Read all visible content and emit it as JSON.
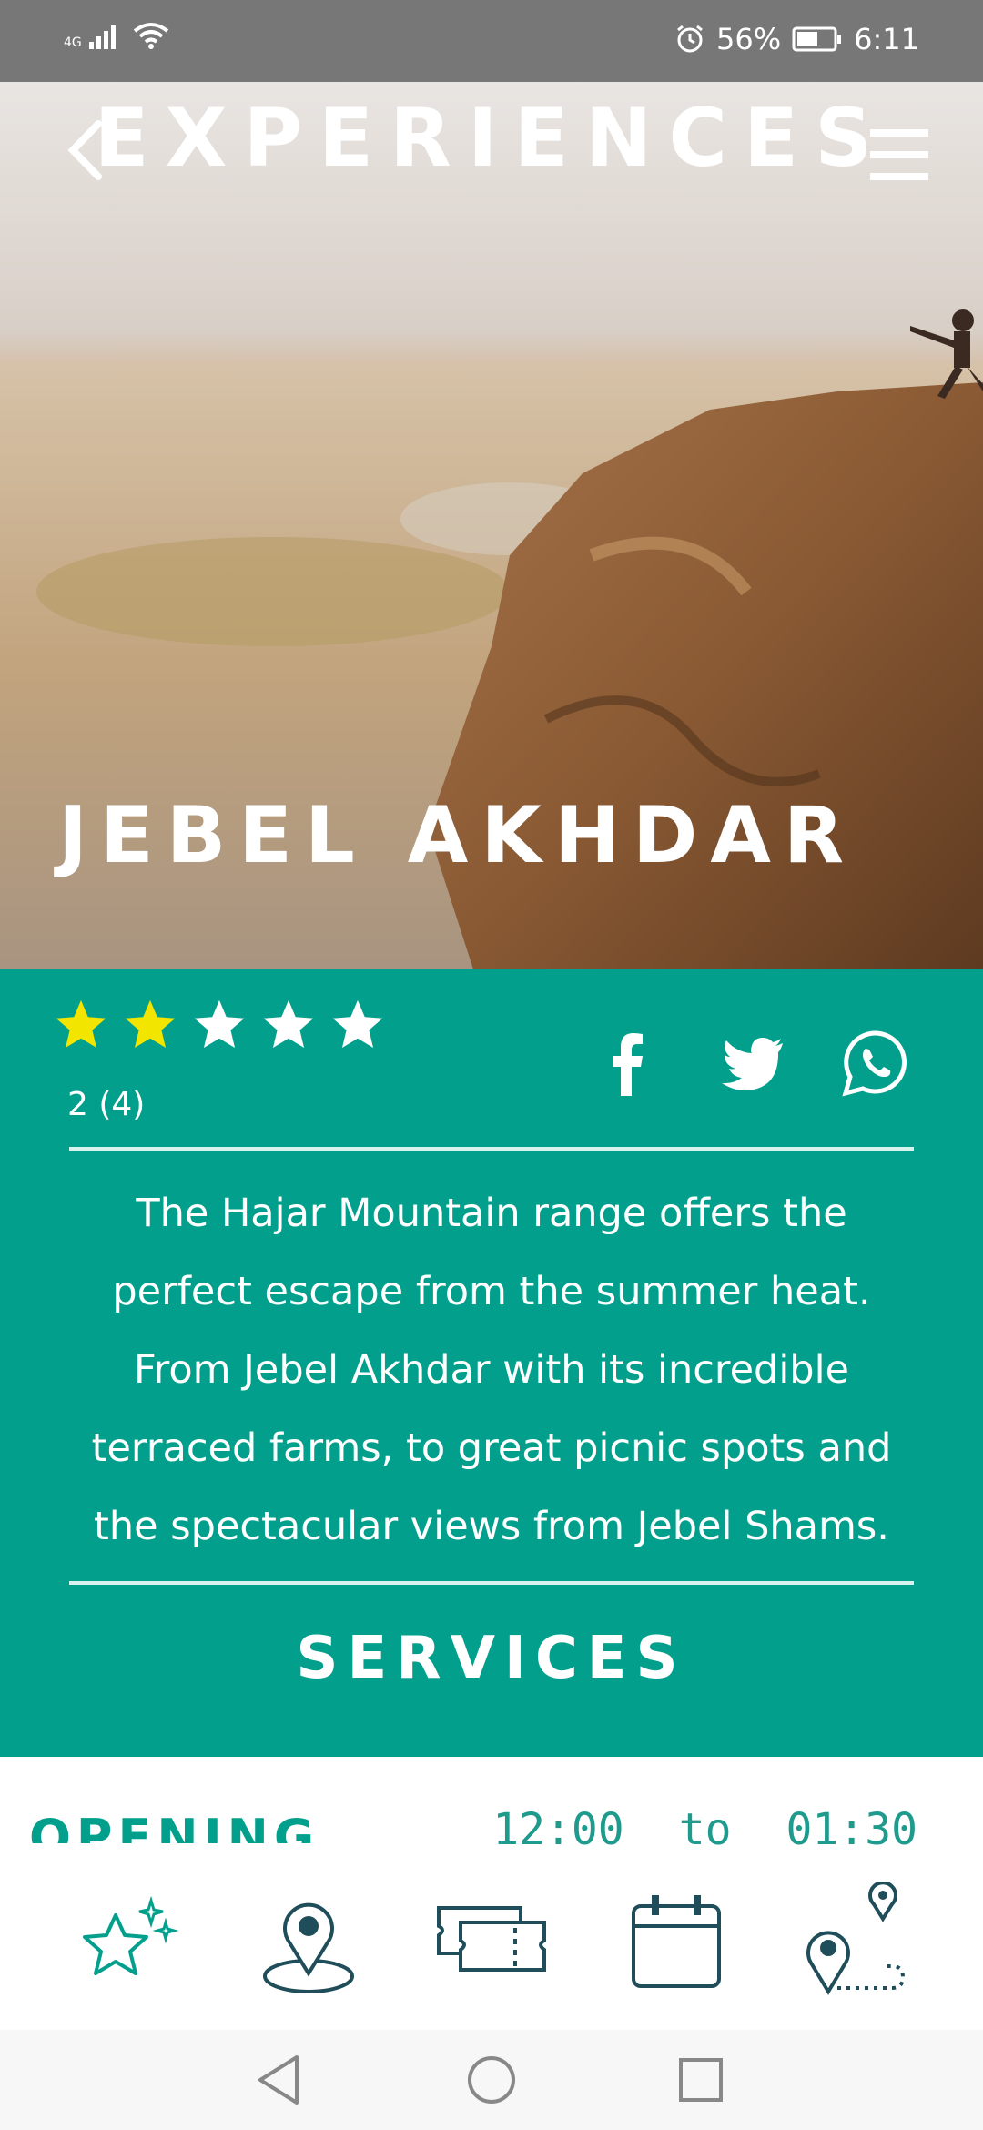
{
  "status_bar": {
    "network": "4G",
    "battery_percent": "56%",
    "time": "6:11"
  },
  "header": {
    "title": "EXPERIENCES"
  },
  "hero": {
    "place_name": "JEBEL AKHDAR"
  },
  "rating": {
    "stars_filled": 2,
    "stars_total": 5,
    "text": "2 (4)",
    "filled_color": "#f2e600",
    "empty_color": "#ffffff"
  },
  "social": [
    "facebook-icon",
    "twitter-icon",
    "whatsapp-icon"
  ],
  "description": "The Hajar Mountain range offers the perfect escape from the summer heat. From Jebel Akhdar with its incredible terraced farms, to great picnic spots and the spectacular views from Jebel Shams.",
  "services_label": "SERVICES",
  "opening": {
    "label": "OPENING",
    "from": "12:00",
    "to_word": "to",
    "until": "01:30"
  },
  "bottom_nav": [
    "experiences-star-icon",
    "location-pin-icon",
    "ticket-icon",
    "calendar-icon",
    "route-icon"
  ],
  "colors": {
    "accent": "#02a08c",
    "nav_icon": "#1f4e5a",
    "status_bar": "#777777"
  }
}
